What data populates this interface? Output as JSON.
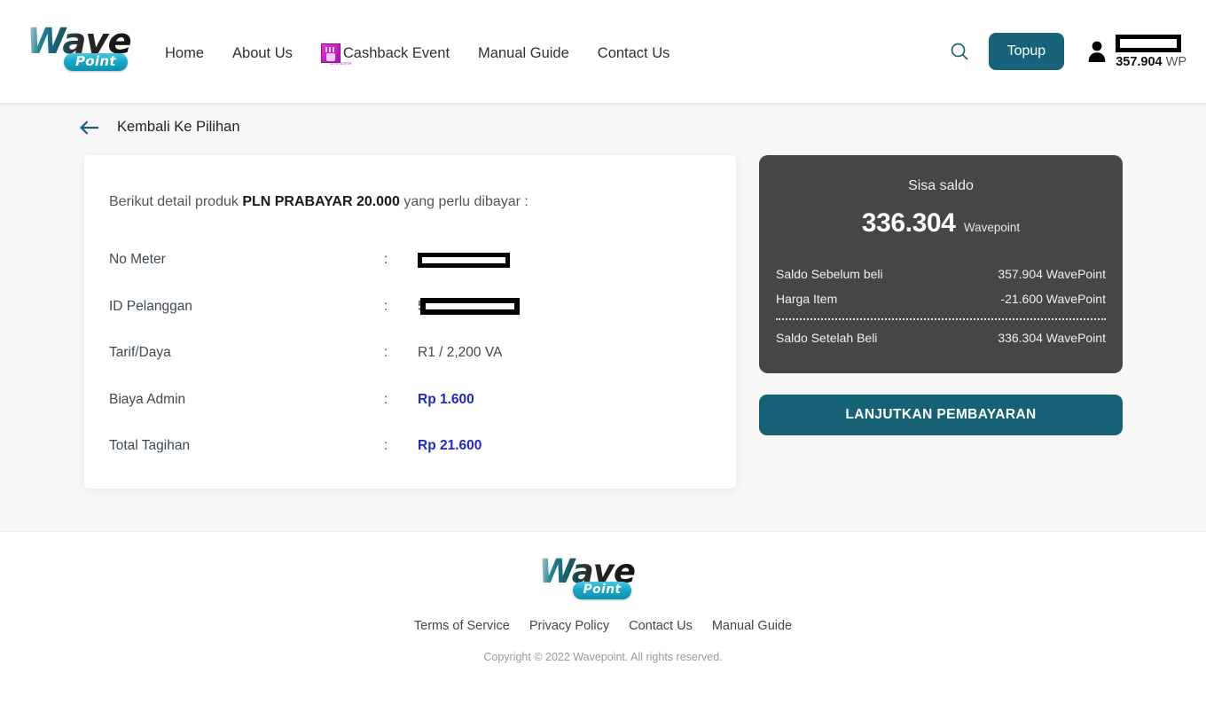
{
  "brand": {
    "logo_wave": "Wave",
    "logo_point": "Point",
    "accent_teal": "#16637a",
    "accent_button": "#156276",
    "money_blue": "#1f27d0",
    "card_dark": "#464646"
  },
  "header": {
    "nav": [
      {
        "label": "Home",
        "icon": null
      },
      {
        "label": "About Us",
        "icon": null
      },
      {
        "label": "Cashback Event",
        "icon": "cashback-gif-icon"
      },
      {
        "label": "Manual Guide",
        "icon": null
      },
      {
        "label": "Contact Us",
        "icon": null
      }
    ],
    "cashback_icon_caption": "unetuone",
    "search_icon": "search-icon",
    "topup_label": "Topup",
    "account_icon": "person-icon",
    "username": "",
    "balance_amount": "357.904",
    "balance_unit": "WP"
  },
  "back": {
    "icon": "arrow-left-icon",
    "label": "Kembali Ke Pilihan"
  },
  "detail": {
    "intro_prefix": "Berikut detail produk ",
    "intro_product": "PLN PRABAYAR 20.000",
    "intro_suffix": " yang perlu dibayar :",
    "colon": ":",
    "rows": [
      {
        "key": "No Meter",
        "value": "",
        "redacted": true,
        "prefix": "",
        "style": "plain"
      },
      {
        "key": "ID Pelanggan",
        "value": "",
        "redacted": true,
        "prefix": "5",
        "style": "plain"
      },
      {
        "key": "Tarif/Daya",
        "value": "R1 / 2,200 VA",
        "redacted": false,
        "prefix": "",
        "style": "plain"
      },
      {
        "key": "Biaya Admin",
        "value": "Rp 1.600",
        "redacted": false,
        "prefix": "",
        "style": "money"
      },
      {
        "key": "Total Tagihan",
        "value": "Rp 21.600",
        "redacted": false,
        "prefix": "",
        "style": "money"
      }
    ]
  },
  "saldo": {
    "title": "Sisa saldo",
    "amount": "336.304",
    "unit": "Wavepoint",
    "rows": [
      {
        "label": "Saldo Sebelum beli",
        "value": "357.904 WavePoint"
      },
      {
        "label": "Harga Item",
        "value": "-21.600 WavePoint"
      },
      {
        "label": "Saldo Setelah Beli",
        "value": "336.304 WavePoint"
      }
    ],
    "pay_button": "LANJUTKAN PEMBAYARAN"
  },
  "footer": {
    "links": [
      "Terms of Service",
      "Privacy Policy",
      "Contact Us",
      "Manual Guide"
    ],
    "copyright": "Copyright © 2022 Wavepoint. All rights reserved."
  }
}
